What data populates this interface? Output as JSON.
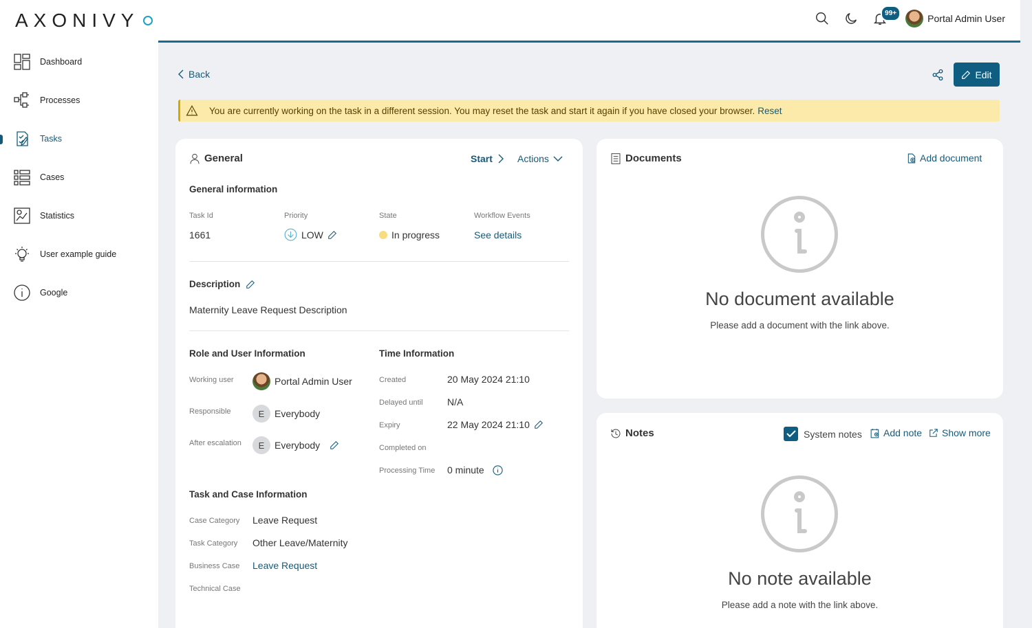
{
  "app": {
    "logo_text": "AXONIVY"
  },
  "sidebar": {
    "items": [
      {
        "label": "Dashboard",
        "icon": "dashboard-icon"
      },
      {
        "label": "Processes",
        "icon": "processes-icon"
      },
      {
        "label": "Tasks",
        "icon": "tasks-icon",
        "active": true
      },
      {
        "label": "Cases",
        "icon": "cases-icon"
      },
      {
        "label": "Statistics",
        "icon": "statistics-icon"
      },
      {
        "label": "User example guide",
        "icon": "lightbulb-icon"
      },
      {
        "label": "Google",
        "icon": "info-icon"
      }
    ]
  },
  "topbar": {
    "notification_badge": "99+",
    "user_name": "Portal Admin User"
  },
  "toolbar": {
    "back_label": "Back",
    "edit_label": "Edit"
  },
  "alert": {
    "message": "You are currently working on the task in a different session. You may reset the task and start it again if you have closed your browser.",
    "reset_label": "Reset"
  },
  "general": {
    "title": "General",
    "start_label": "Start",
    "actions_label": "Actions",
    "info_heading": "General information",
    "task_id_label": "Task Id",
    "task_id": "1661",
    "priority_label": "Priority",
    "priority": "LOW",
    "state_label": "State",
    "state": "In progress",
    "workflow_label": "Workflow Events",
    "workflow_link": "See details",
    "description_heading": "Description",
    "description": "Maternity Leave Request Description",
    "role_heading": "Role and User Information",
    "working_user_label": "Working user",
    "working_user": "Portal Admin User",
    "responsible_label": "Responsible",
    "responsible": "Everybody",
    "responsible_initial": "E",
    "after_escalation_label": "After escalation",
    "after_escalation": "Everybody",
    "after_escalation_initial": "E",
    "time_heading": "Time Information",
    "created_label": "Created",
    "created": "20 May 2024 21:10",
    "delayed_label": "Delayed until",
    "delayed": "N/A",
    "expiry_label": "Expiry",
    "expiry": "22 May 2024 21:10",
    "completed_label": "Completed on",
    "processing_label": "Processing Time",
    "processing": "0 minute",
    "case_heading": "Task and Case Information",
    "case_category_label": "Case Category",
    "case_category": "Leave Request",
    "task_category_label": "Task Category",
    "task_category": "Other Leave/Maternity",
    "business_case_label": "Business Case",
    "business_case": "Leave Request",
    "technical_case_label": "Technical Case"
  },
  "documents": {
    "title": "Documents",
    "add_label": "Add document",
    "empty_title": "No document available",
    "empty_sub": "Please add a document with the link above."
  },
  "notes": {
    "title": "Notes",
    "system_notes_label": "System notes",
    "system_notes_checked": true,
    "add_label": "Add note",
    "show_more_label": "Show more",
    "empty_title": "No note available",
    "empty_sub": "Please add a note with the link above."
  },
  "colors": {
    "accent": "#0f5e82",
    "link": "#155a7a",
    "alert_bg": "#fbeaa9"
  }
}
